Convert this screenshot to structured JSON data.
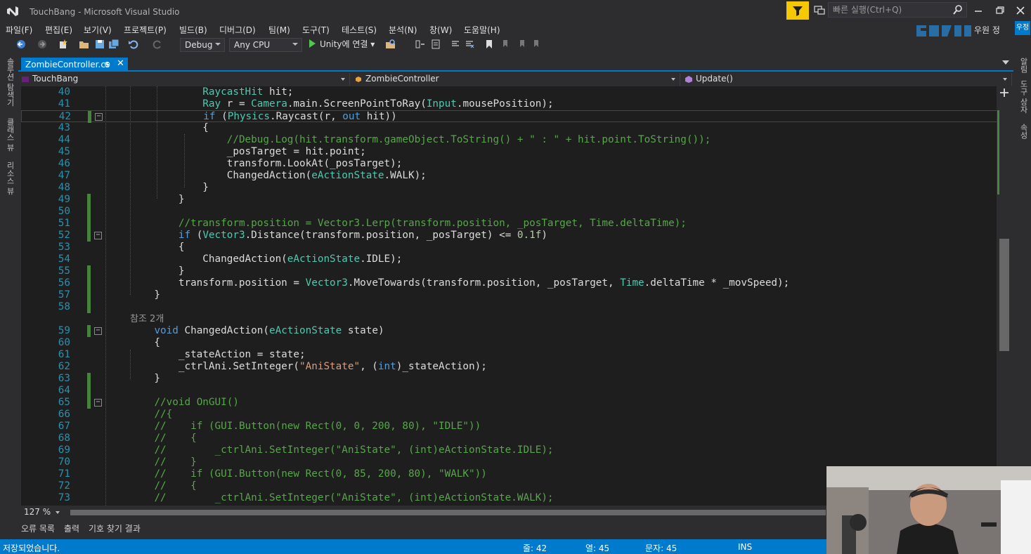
{
  "window": {
    "title": "TouchBang - Microsoft Visual Studio",
    "quick_launch_placeholder": "빠른 실행(Ctrl+Q)"
  },
  "menu": [
    "파일(F)",
    "편집(E)",
    "보기(V)",
    "프로젝트(P)",
    "빌드(B)",
    "디버그(D)",
    "팀(M)",
    "도구(T)",
    "테스트(S)",
    "분석(N)",
    "창(W)",
    "도움말(H)"
  ],
  "user": {
    "name": "우원 정",
    "badge": "우정"
  },
  "toolbar": {
    "config": "Debug",
    "platform": "Any CPU",
    "run_label": "Unity에 연결"
  },
  "left_panel": [
    "솔루션 탐색기",
    "클래스 뷰",
    "리소스 뷰"
  ],
  "right_panel": [
    "알림",
    "도구 상자",
    "속성"
  ],
  "tab": {
    "label": "ZombieController.cs",
    "pin": "⊕",
    "close": "✕"
  },
  "navbar": {
    "project": "TouchBang",
    "class": "ZombieController",
    "member": "Update()"
  },
  "code": {
    "ref_count": "참조 2개",
    "lines": [
      {
        "n": "40",
        "t": [
          [
            "",
            "            "
          ],
          [
            "ty",
            "RaycastHit"
          ],
          [
            "",
            " hit;"
          ]
        ]
      },
      {
        "n": "41",
        "t": [
          [
            "",
            "            "
          ],
          [
            "ty",
            "Ray"
          ],
          [
            "",
            " r = "
          ],
          [
            "ty",
            "Camera"
          ],
          [
            "",
            ".main.ScreenPointToRay("
          ],
          [
            "ty",
            "Input"
          ],
          [
            "",
            ".mousePosition);"
          ]
        ]
      },
      {
        "n": "42",
        "t": [
          [
            "",
            "            "
          ],
          [
            "kw",
            "if"
          ],
          [
            "",
            " ("
          ],
          [
            "ty",
            "Physics"
          ],
          [
            "",
            ".Raycast(r, "
          ],
          [
            "kw",
            "out"
          ],
          [
            "",
            " hit))"
          ]
        ]
      },
      {
        "n": "43",
        "t": [
          [
            "",
            "            {"
          ]
        ]
      },
      {
        "n": "44",
        "t": [
          [
            "",
            "                "
          ],
          [
            "cm",
            "//Debug.Log(hit.transform.gameObject.ToString() + \" : \" + hit.point.ToString());"
          ]
        ]
      },
      {
        "n": "45",
        "t": [
          [
            "",
            "                _posTarget = hit.point;"
          ]
        ]
      },
      {
        "n": "46",
        "t": [
          [
            "",
            "                transform.LookAt(_posTarget);"
          ]
        ]
      },
      {
        "n": "47",
        "t": [
          [
            "",
            "                ChangedAction("
          ],
          [
            "ty",
            "eActionState"
          ],
          [
            "",
            ".WALK);"
          ]
        ]
      },
      {
        "n": "48",
        "t": [
          [
            "",
            "            }"
          ]
        ]
      },
      {
        "n": "49",
        "t": [
          [
            "",
            "        }"
          ]
        ]
      },
      {
        "n": "50",
        "t": [
          [
            "",
            ""
          ]
        ]
      },
      {
        "n": "51",
        "t": [
          [
            "",
            "        "
          ],
          [
            "cm",
            "//transform.position = Vector3.Lerp(transform.position, _posTarget, Time.deltaTime);"
          ]
        ]
      },
      {
        "n": "52",
        "t": [
          [
            "",
            "        "
          ],
          [
            "kw",
            "if"
          ],
          [
            "",
            " ("
          ],
          [
            "ty",
            "Vector3"
          ],
          [
            "",
            ".Distance(transform.position, _posTarget) <= "
          ],
          [
            "nm",
            "0.1f"
          ],
          [
            "",
            ")"
          ]
        ]
      },
      {
        "n": "53",
        "t": [
          [
            "",
            "        {"
          ]
        ]
      },
      {
        "n": "54",
        "t": [
          [
            "",
            "            ChangedAction("
          ],
          [
            "ty",
            "eActionState"
          ],
          [
            "",
            ".IDLE);"
          ]
        ]
      },
      {
        "n": "55",
        "t": [
          [
            "",
            "        }"
          ]
        ]
      },
      {
        "n": "56",
        "t": [
          [
            "",
            "        transform.position = "
          ],
          [
            "ty",
            "Vector3"
          ],
          [
            "",
            ".MoveTowards(transform.position, _posTarget, "
          ],
          [
            "ty",
            "Time"
          ],
          [
            "",
            ".deltaTime * _movSpeed);"
          ]
        ]
      },
      {
        "n": "57",
        "t": [
          [
            "",
            "    }"
          ]
        ]
      },
      {
        "n": "58",
        "t": [
          [
            "",
            ""
          ]
        ]
      },
      {
        "n": "59",
        "t": [
          [
            "",
            "    "
          ],
          [
            "kw",
            "void"
          ],
          [
            "",
            " ChangedAction("
          ],
          [
            "ty",
            "eActionState"
          ],
          [
            "",
            " state)"
          ]
        ]
      },
      {
        "n": "60",
        "t": [
          [
            "",
            "    {"
          ]
        ]
      },
      {
        "n": "61",
        "t": [
          [
            "",
            "        _stateAction = state;"
          ]
        ]
      },
      {
        "n": "62",
        "t": [
          [
            "",
            "        _ctrlAni.SetInteger("
          ],
          [
            "st",
            "\"AniState\""
          ],
          [
            "",
            ", ("
          ],
          [
            "kw",
            "int"
          ],
          [
            "",
            ")_stateAction);"
          ]
        ]
      },
      {
        "n": "63",
        "t": [
          [
            "",
            "    }"
          ]
        ]
      },
      {
        "n": "64",
        "t": [
          [
            "",
            ""
          ]
        ]
      },
      {
        "n": "65",
        "t": [
          [
            "",
            "    "
          ],
          [
            "cm",
            "//void OnGUI()"
          ]
        ]
      },
      {
        "n": "66",
        "t": [
          [
            "",
            "    "
          ],
          [
            "cm",
            "//{"
          ]
        ]
      },
      {
        "n": "67",
        "t": [
          [
            "",
            "    "
          ],
          [
            "cm",
            "//    if (GUI.Button(new Rect(0, 0, 200, 80), \"IDLE\"))"
          ]
        ]
      },
      {
        "n": "68",
        "t": [
          [
            "",
            "    "
          ],
          [
            "cm",
            "//    {"
          ]
        ]
      },
      {
        "n": "69",
        "t": [
          [
            "",
            "    "
          ],
          [
            "cm",
            "//        _ctrlAni.SetInteger(\"AniState\", (int)eActionState.IDLE);"
          ]
        ]
      },
      {
        "n": "70",
        "t": [
          [
            "",
            "    "
          ],
          [
            "cm",
            "//    }"
          ]
        ]
      },
      {
        "n": "71",
        "t": [
          [
            "",
            "    "
          ],
          [
            "cm",
            "//    if (GUI.Button(new Rect(0, 85, 200, 80), \"WALK\"))"
          ]
        ]
      },
      {
        "n": "72",
        "t": [
          [
            "",
            "    "
          ],
          [
            "cm",
            "//    {"
          ]
        ]
      },
      {
        "n": "73",
        "t": [
          [
            "",
            "    "
          ],
          [
            "cm",
            "//        _ctrlAni.SetInteger(\"AniState\", (int)eActionState.WALK);"
          ]
        ]
      }
    ]
  },
  "zoom": "127 %",
  "tool_tabs": [
    "오류 목록",
    "출력",
    "기호 찾기 결과"
  ],
  "status": {
    "message": "저장되었습니다.",
    "line": "줄: 42",
    "col": "열: 45",
    "ch": "문자: 45",
    "ins": "INS"
  },
  "colors": {
    "accent": "#007acc",
    "editor_bg": "#1e1e1e",
    "keyword": "#569cd6",
    "type": "#4ec9b0",
    "comment": "#57a64a",
    "string": "#d69d85",
    "line_number": "#2b91af"
  }
}
